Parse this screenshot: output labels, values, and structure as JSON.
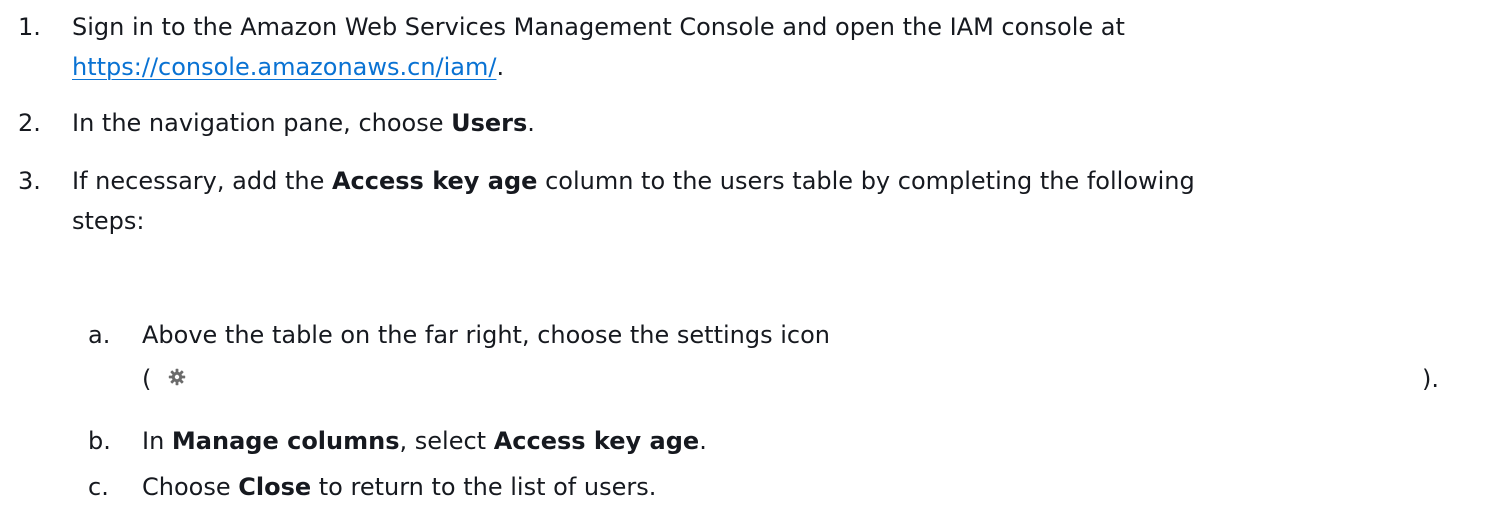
{
  "steps": [
    {
      "num": "1.",
      "line1": "Sign in to the Amazon Web Services Management Console and open the IAM console at",
      "link": "https://console.amazonaws.cn/iam/",
      "after_link": "."
    },
    {
      "num": "2.",
      "before": "In the navigation pane, choose ",
      "bold": "Users",
      "after": "."
    },
    {
      "num": "3.",
      "before": "If necessary, add the ",
      "bold": "Access key age",
      "after": " column to the users table by completing the following",
      "line2": "steps:"
    }
  ],
  "substeps": [
    {
      "letter": "a.",
      "text": "Above the table on the far right, choose the settings icon",
      "open_paren": "(",
      "close_paren": ").",
      "icon": "gear-icon"
    },
    {
      "letter": "b.",
      "before": "In ",
      "bold1": "Manage columns",
      "middle": ", select ",
      "bold2": "Access key age",
      "after": "."
    },
    {
      "letter": "c.",
      "before": "Choose ",
      "bold": "Close",
      "after": " to return to the list of users."
    }
  ]
}
